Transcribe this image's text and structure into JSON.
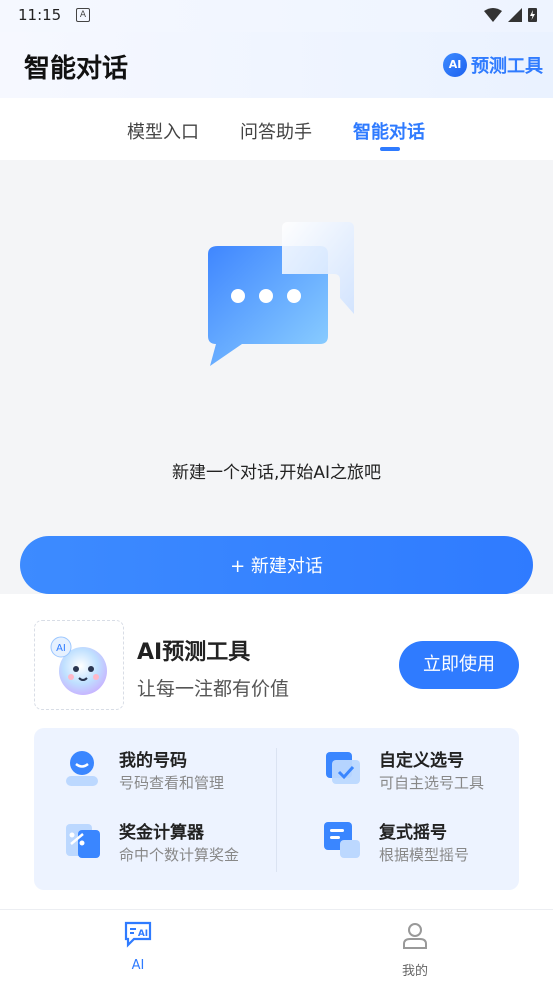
{
  "status": {
    "time": "11:15",
    "a_badge": "A"
  },
  "header": {
    "title": "智能对话",
    "ai_badge": "AI",
    "tool_link": "预测工具"
  },
  "tabs": [
    {
      "label": "模型入口"
    },
    {
      "label": "问答助手"
    },
    {
      "label": "智能对话",
      "active": true
    }
  ],
  "empty": {
    "text": "新建一个对话,开始AI之旅吧"
  },
  "new_chat": {
    "label": "+ 新建对话"
  },
  "ai_tool_card": {
    "title": "AI预测工具",
    "subtitle": "让每一注都有价值",
    "button": "立即使用",
    "mascot_text": "AI"
  },
  "features": [
    {
      "title": "我的号码",
      "subtitle": "号码查看和管理",
      "icon": "user-number-icon"
    },
    {
      "title": "自定义选号",
      "subtitle": "可自主选号工具",
      "icon": "custom-select-icon"
    },
    {
      "title": "奖金计算器",
      "subtitle": "命中个数计算奖金",
      "icon": "calculator-icon"
    },
    {
      "title": "复式摇号",
      "subtitle": "根据模型摇号",
      "icon": "lottery-draw-icon"
    }
  ],
  "bottom_nav": [
    {
      "label": "AI",
      "icon": "ai-chat-icon",
      "active": true
    },
    {
      "label": "我的",
      "icon": "profile-icon",
      "active": false
    }
  ],
  "colors": {
    "accent": "#2f7bff",
    "panel": "#edf3ff",
    "background": "#f4f5f7"
  }
}
